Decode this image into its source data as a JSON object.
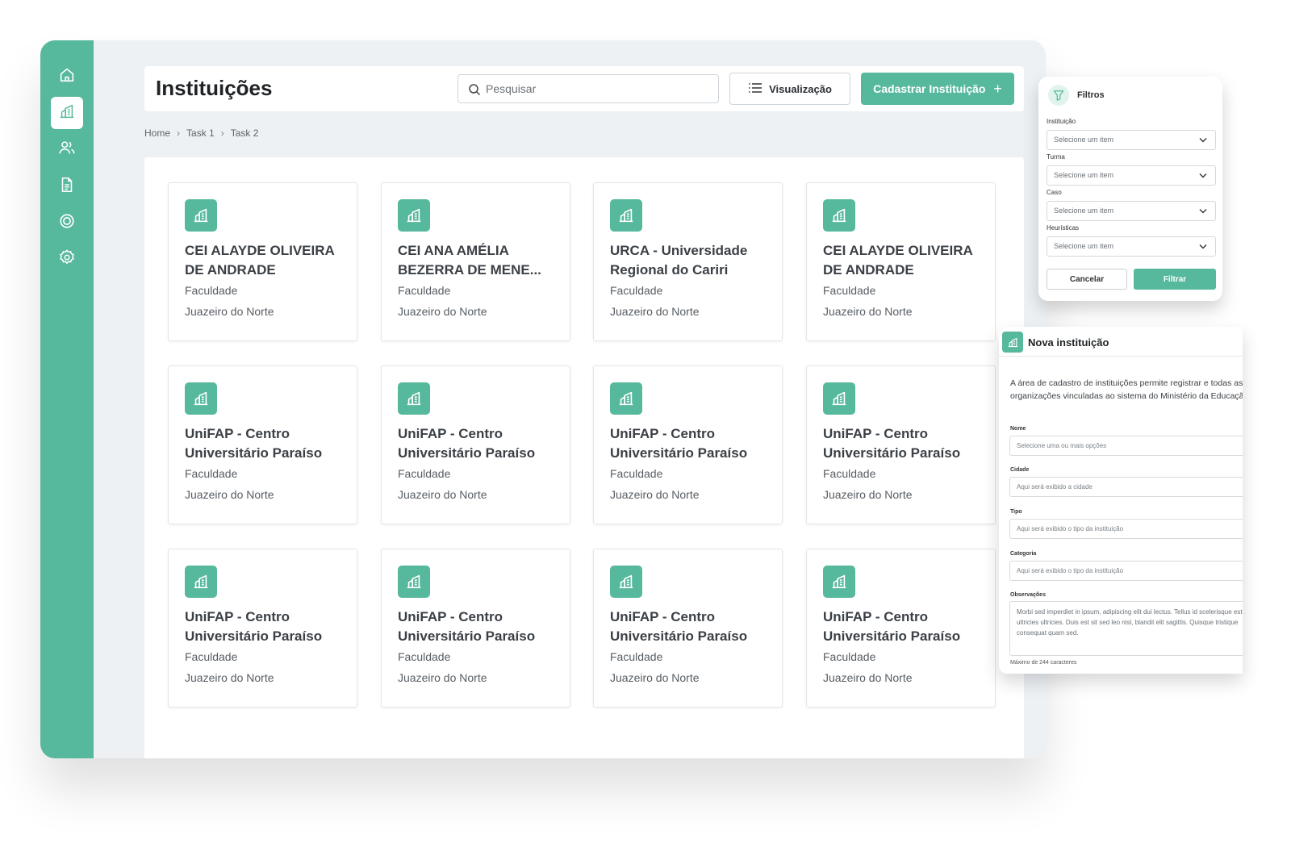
{
  "header": {
    "title": "Instituições",
    "search_placeholder": "Pesquisar",
    "view_label": "Visualização",
    "add_label": "Cadastrar Instituição",
    "add_symbol": "+"
  },
  "sidebar": {
    "items": [
      {
        "name": "home",
        "icon": "home-icon"
      },
      {
        "name": "institutions",
        "icon": "building-icon",
        "active": true
      },
      {
        "name": "users",
        "icon": "users-icon"
      },
      {
        "name": "documents",
        "icon": "document-icon"
      },
      {
        "name": "target",
        "icon": "target-icon"
      },
      {
        "name": "settings",
        "icon": "gear-icon"
      }
    ]
  },
  "breadcrumb": [
    "Home",
    "Task 1",
    "Task 2"
  ],
  "cards": [
    {
      "title": "CEI ALAYDE OLIVEIRA DE ANDRADE",
      "type": "Faculdade",
      "city": "Juazeiro do Norte"
    },
    {
      "title": "CEI ANA AMÉLIA BEZERRA DE MENE...",
      "type": "Faculdade",
      "city": "Juazeiro do Norte"
    },
    {
      "title": "URCA - Universidade Regional do Cariri",
      "type": "Faculdade",
      "city": "Juazeiro do Norte"
    },
    {
      "title": "CEI ALAYDE OLIVEIRA DE ANDRADE",
      "type": "Faculdade",
      "city": "Juazeiro do Norte"
    },
    {
      "title": "UniFAP - Centro Universitário Paraíso",
      "type": "Faculdade",
      "city": "Juazeiro do Norte"
    },
    {
      "title": "UniFAP - Centro Universitário Paraíso",
      "type": "Faculdade",
      "city": "Juazeiro do Norte"
    },
    {
      "title": "UniFAP - Centro Universitário Paraíso",
      "type": "Faculdade",
      "city": "Juazeiro do Norte"
    },
    {
      "title": "UniFAP - Centro Universitário Paraíso",
      "type": "Faculdade",
      "city": "Juazeiro do Norte"
    },
    {
      "title": "UniFAP - Centro Universitário Paraíso",
      "type": "Faculdade",
      "city": "Juazeiro do Norte"
    },
    {
      "title": "UniFAP - Centro Universitário Paraíso",
      "type": "Faculdade",
      "city": "Juazeiro do Norte"
    },
    {
      "title": "UniFAP - Centro Universitário Paraíso",
      "type": "Faculdade",
      "city": "Juazeiro do Norte"
    },
    {
      "title": "UniFAP - Centro Universitário Paraíso",
      "type": "Faculdade",
      "city": "Juazeiro do Norte"
    }
  ],
  "filters": {
    "title": "Filtros",
    "fields": [
      {
        "label": "Instituição",
        "value": "Selecione um item"
      },
      {
        "label": "Turma",
        "value": "Selecione um item"
      },
      {
        "label": "Caso",
        "value": "Selecione um item"
      },
      {
        "label": "Heurísticas",
        "value": "Selecione um item"
      }
    ],
    "cancel_label": "Cancelar",
    "submit_label": "Filtrar"
  },
  "new_institution": {
    "title": "Nova instituição",
    "description": "A área de cadastro de instituições permite registrar e todas as organizações vinculadas ao sistema do Ministério da Educação.",
    "fields": [
      {
        "label": "Nome",
        "placeholder": "Selecione uma ou mais opções"
      },
      {
        "label": "Cidade",
        "placeholder": "Aqui será exibido a cidade"
      },
      {
        "label": "Tipo",
        "placeholder": "Aqui será exibido o tipo da instituição"
      },
      {
        "label": "Categoria",
        "placeholder": "Aqui será exibido o tipo da instituição"
      }
    ],
    "notes_label": "Observações",
    "notes_value": "Morbi sed imperdiet in ipsum, adipiscing elit dui lectus. Tellus id scelerisque est ultricies ultricies. Duis est sit sed leo nisl, blandit elit sagittis. Quisque tristique consequat quam sed.",
    "notes_hint": "Máximo de 244 caracteres"
  },
  "colors": {
    "accent": "#56b89c",
    "background": "#edf1f4"
  }
}
